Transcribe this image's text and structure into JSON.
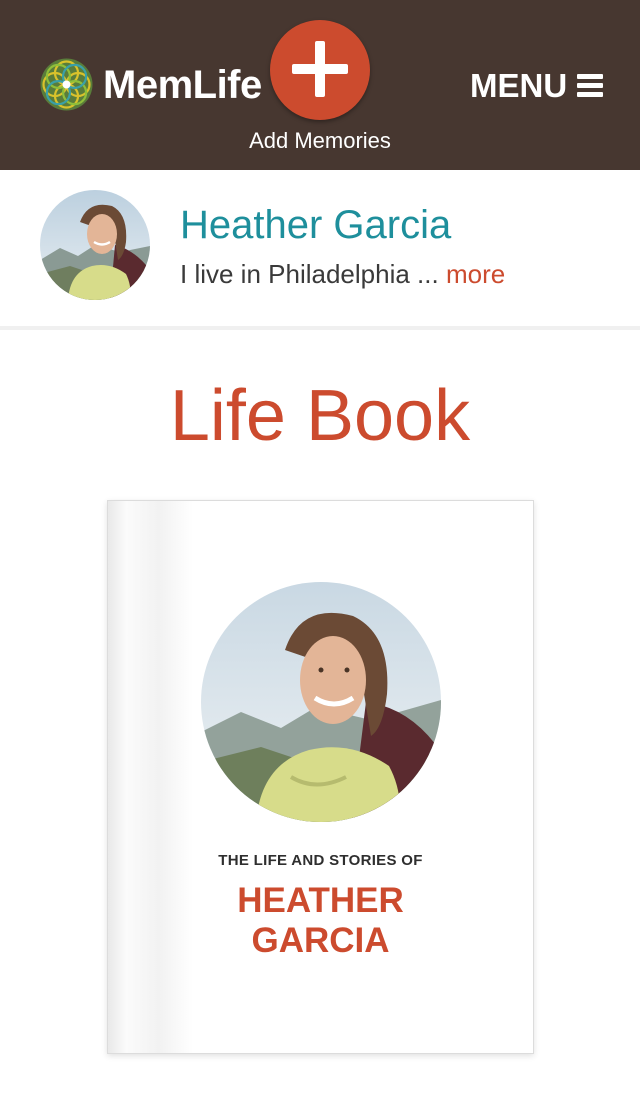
{
  "header": {
    "brand": "MemLife",
    "add_label": "Add Memories",
    "menu_label": "MENU",
    "icons": [
      "memlife-logo-icon",
      "plus-icon",
      "hamburger-icon"
    ],
    "colors": {
      "background": "#473730",
      "accent": "#cc4b2e"
    }
  },
  "profile": {
    "name": "Heather Garcia",
    "bio": "I live in Philadelphia ...",
    "more_label": "more",
    "colors": {
      "name": "#1e8f9c",
      "link": "#cc4b2e"
    }
  },
  "main": {
    "title": "Life Book",
    "book": {
      "subtitle": "THE LIFE AND STORIES OF",
      "name_line1": "HEATHER",
      "name_line2": "GARCIA"
    }
  }
}
